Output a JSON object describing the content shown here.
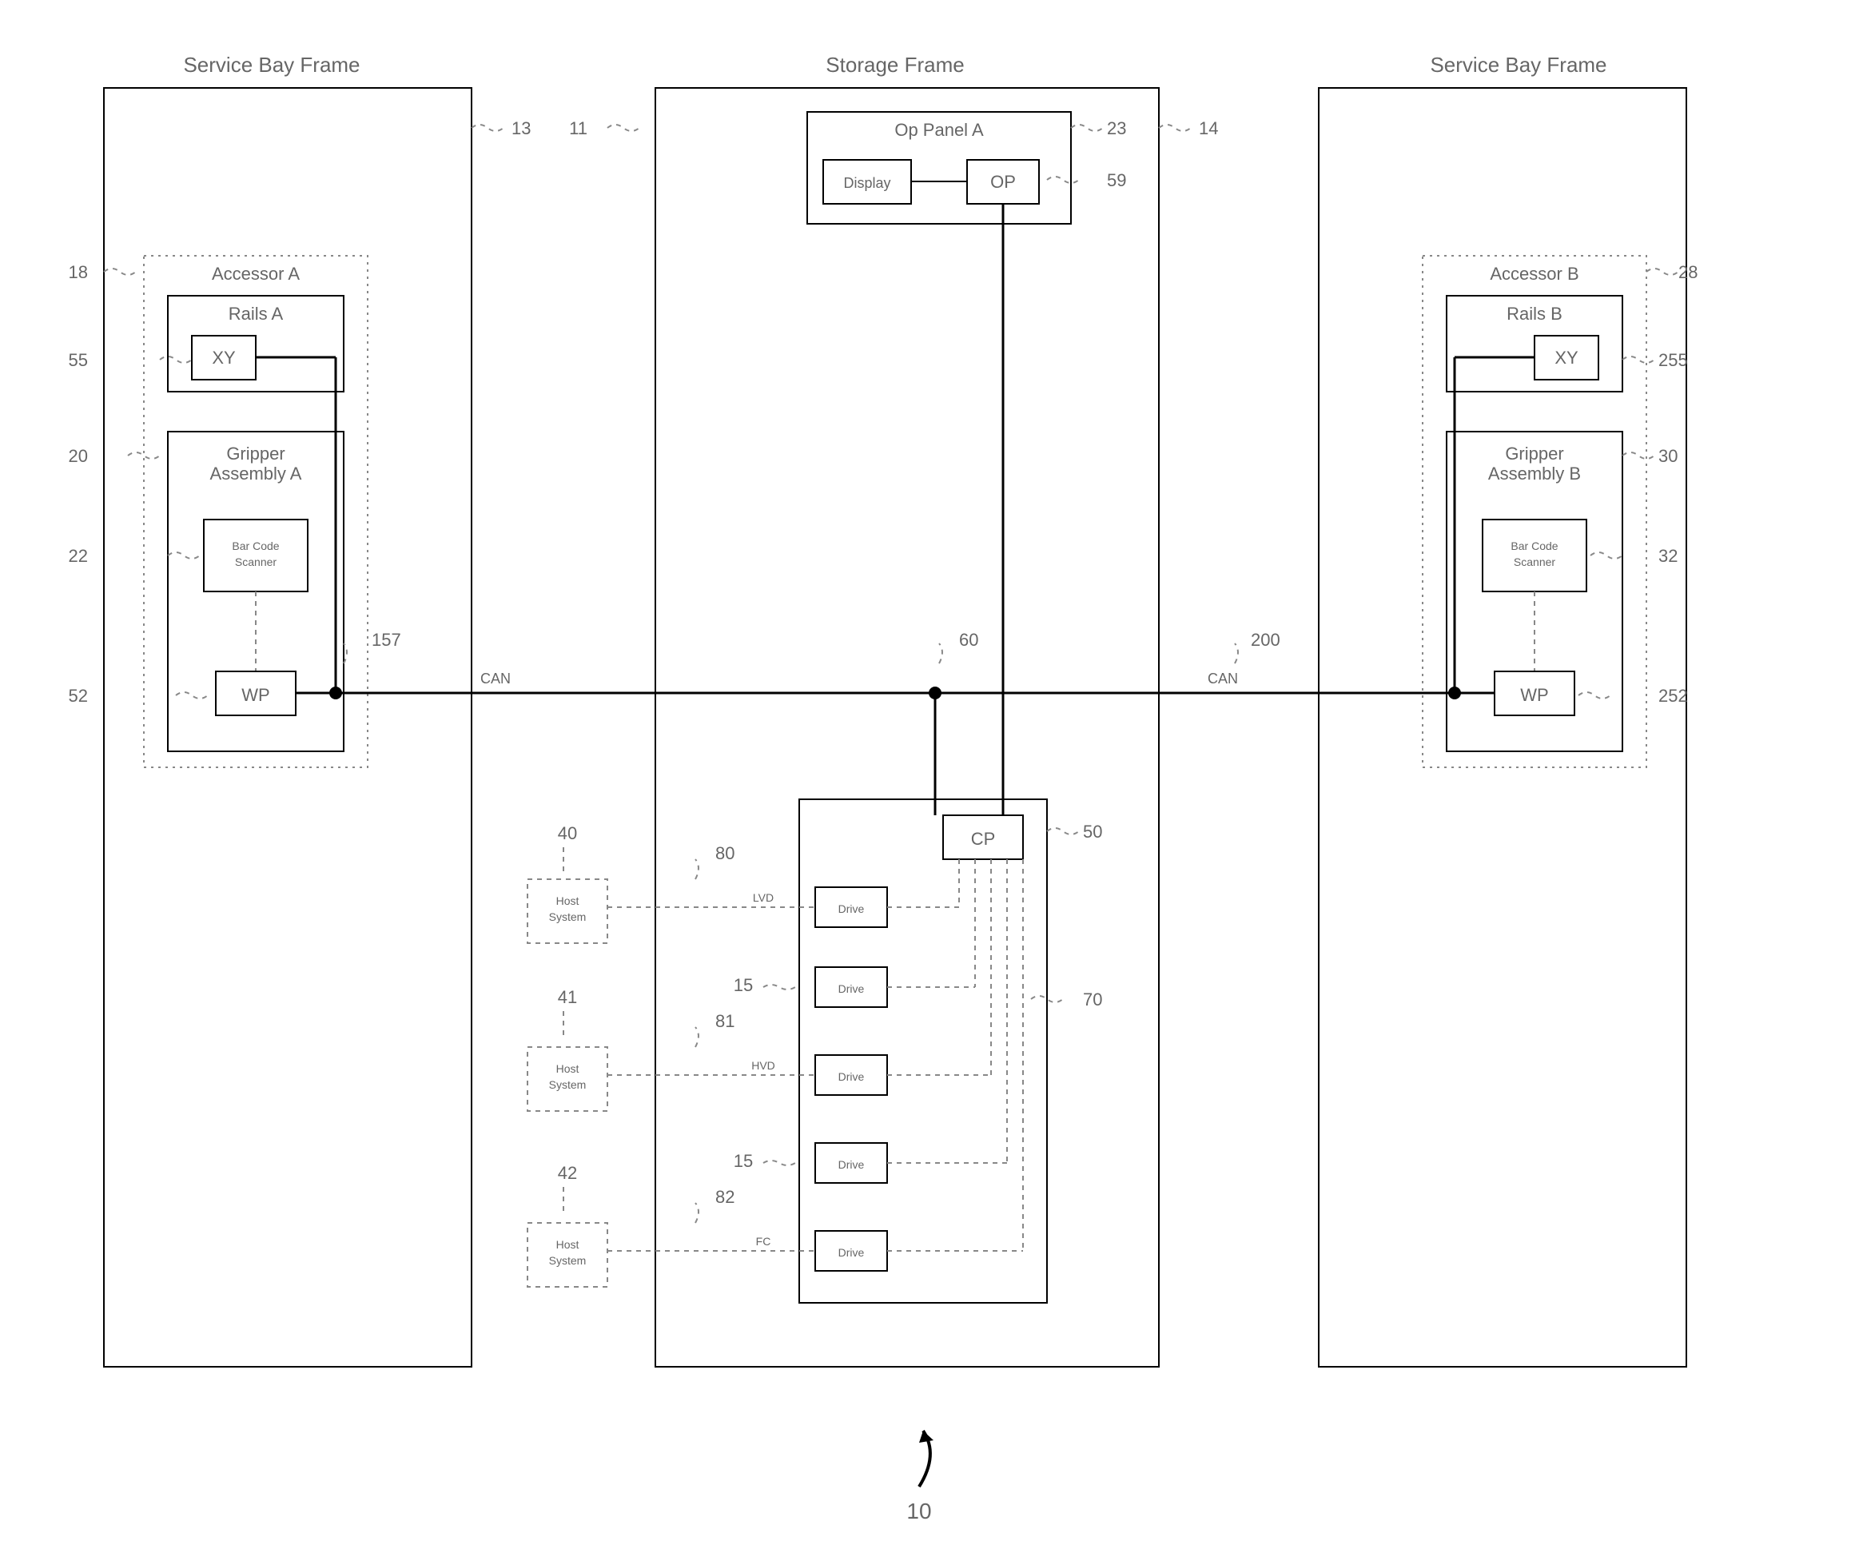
{
  "frames": {
    "left": {
      "title": "Service Bay Frame",
      "ref": "13"
    },
    "center": {
      "title": "Storage Frame",
      "ref": "11"
    },
    "right": {
      "title": "Service Bay Frame",
      "ref": "14"
    }
  },
  "accessors": {
    "a": {
      "title": "Accessor A",
      "ref": "18",
      "rails": {
        "title": "Rails A",
        "box": "XY",
        "ref": "55"
      },
      "gripper": {
        "title": "Gripper\nAssembly A",
        "ref": "20",
        "scanner": {
          "label": "Bar Code\nScanner",
          "ref": "22"
        },
        "wp": {
          "label": "WP",
          "ref": "52"
        }
      }
    },
    "b": {
      "title": "Accessor B",
      "ref": "28",
      "rails": {
        "title": "Rails B",
        "box": "XY",
        "ref": "255"
      },
      "gripper": {
        "title": "Gripper\nAssembly B",
        "ref": "30",
        "scanner": {
          "label": "Bar Code\nScanner",
          "ref": "32"
        },
        "wp": {
          "label": "WP",
          "ref": "252"
        }
      }
    }
  },
  "op_panel": {
    "title": "Op Panel A",
    "ref": "23",
    "display": "Display",
    "op": {
      "label": "OP",
      "ref": "59"
    }
  },
  "bus": {
    "label": "CAN",
    "left_ref": "157",
    "center_ref": "60",
    "right_ref": "200"
  },
  "cp": {
    "label": "CP",
    "ref": "50",
    "lines_ref": "70"
  },
  "drives": {
    "label": "Drive",
    "ref_a": "15",
    "ref_b": "15"
  },
  "hosts": {
    "h1": {
      "label": "Host\nSystem",
      "ref": "40",
      "bus": "LVD",
      "bus_ref": "80"
    },
    "h2": {
      "label": "Host\nSystem",
      "ref": "41",
      "bus": "HVD",
      "bus_ref": "81"
    },
    "h3": {
      "label": "Host\nSystem",
      "ref": "42",
      "bus": "FC",
      "bus_ref": "82"
    }
  },
  "figure_ref": "10"
}
